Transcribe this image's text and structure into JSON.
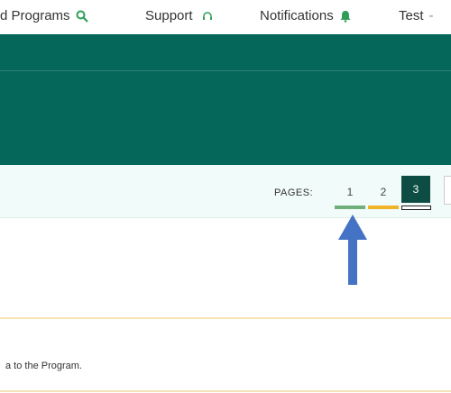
{
  "topnav": {
    "programs_label": "d Programs",
    "support_label": "Support",
    "notifications_label": "Notifications",
    "user_label": "Test",
    "user_suffix": "-"
  },
  "pager": {
    "label": "PAGES:",
    "pages": [
      "1",
      "2",
      "3"
    ],
    "current_page": "3",
    "indicator_colors": [
      "#6fb07a",
      "#f0b429",
      "#ffffff"
    ]
  },
  "annotation": {
    "arrow_color": "#4472c4",
    "points_to": "page-indicators"
  },
  "content": {
    "note_text": "a to the Program."
  },
  "colors": {
    "header_bg": "#05665a",
    "pager_bg": "#f1fbf9",
    "accent_green": "#2e9e5a"
  }
}
